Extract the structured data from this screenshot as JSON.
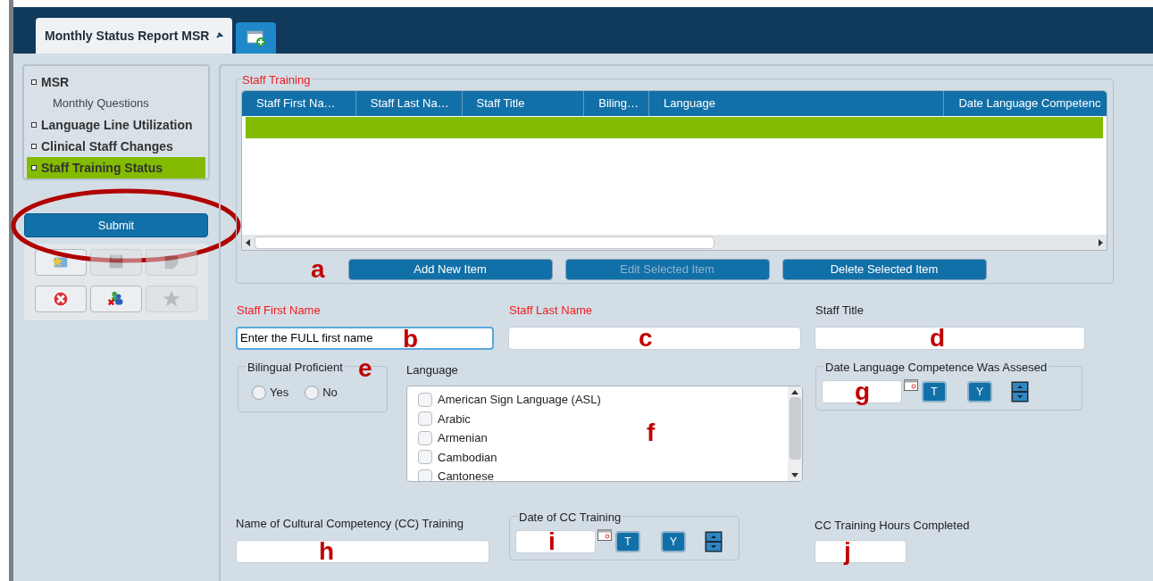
{
  "tabs": [
    {
      "kind": "document",
      "label": "Monthly Status Report MSR",
      "selected": true
    },
    {
      "kind": "new",
      "selected": false
    }
  ],
  "nav": {
    "items": [
      {
        "label": "MSR",
        "selected": false,
        "children": [
          {
            "label": "Monthly Questions",
            "selected": false
          }
        ]
      },
      {
        "label": "Language Line Utilization",
        "selected": false
      },
      {
        "label": "Clinical Staff Changes",
        "selected": false
      },
      {
        "label": "Staff Training Status",
        "selected": true
      }
    ]
  },
  "submit_button": {
    "label": "Submit",
    "circled": true
  },
  "toolbar": {
    "buttons": [
      {
        "kind": "star-folder",
        "disabled": false
      },
      {
        "kind": "disk",
        "disabled": true
      },
      {
        "kind": "note",
        "disabled": true
      },
      {
        "kind": "cancel",
        "disabled": false
      },
      {
        "kind": "people",
        "disabled": false
      },
      {
        "kind": "star",
        "disabled": true
      }
    ]
  },
  "staff_training": {
    "legend": "Staff Training",
    "table": {
      "columns": [
        "Staff First Na…",
        "Staff Last Na…",
        "Staff Title",
        "Biling…",
        "Language",
        "Date Language Competenc"
      ],
      "rows": [
        {
          "selected": true
        }
      ]
    },
    "annotation": "a",
    "buttons": [
      {
        "label": "Add New Item",
        "disabled": false
      },
      {
        "label": "Edit Selected Item",
        "disabled": true
      },
      {
        "label": "Delete Selected Item",
        "disabled": false
      }
    ]
  },
  "fields": {
    "first_name": {
      "label": "Staff First Name",
      "required": true,
      "value": "Enter the FULL first name",
      "focused": true,
      "annotation": "b"
    },
    "last_name": {
      "label": "Staff Last Name",
      "required": true,
      "annotation": "c"
    },
    "title": {
      "label": "Staff Title",
      "required": false,
      "annotation": "d"
    },
    "bilingual": {
      "legend": "Bilingual Proficient",
      "annotation": "e",
      "options": [
        {
          "label": "Yes",
          "selected": false
        },
        {
          "label": "No",
          "selected": false
        }
      ]
    },
    "language": {
      "label": "Language",
      "annotation": "f",
      "items": [
        {
          "label": "American Sign Language (ASL)",
          "checked": false
        },
        {
          "label": "Arabic",
          "checked": false
        },
        {
          "label": "Armenian",
          "checked": false
        },
        {
          "label": "Cambodian",
          "checked": false
        },
        {
          "label": "Cantonese",
          "checked": false
        }
      ]
    },
    "competence_date": {
      "legend": "Date Language Competence Was Assesed",
      "annotation": "g",
      "today_button": "T",
      "yesterday_button": "Y"
    },
    "cc_training_name": {
      "label": "Name of Cultural Competency (CC) Training",
      "annotation": "h"
    },
    "cc_training_date": {
      "legend": "Date of CC Training",
      "annotation": "i",
      "today_button": "T",
      "yesterday_button": "Y"
    },
    "cc_training_hours": {
      "label": "CC Training Hours Completed",
      "annotation": "j"
    }
  }
}
